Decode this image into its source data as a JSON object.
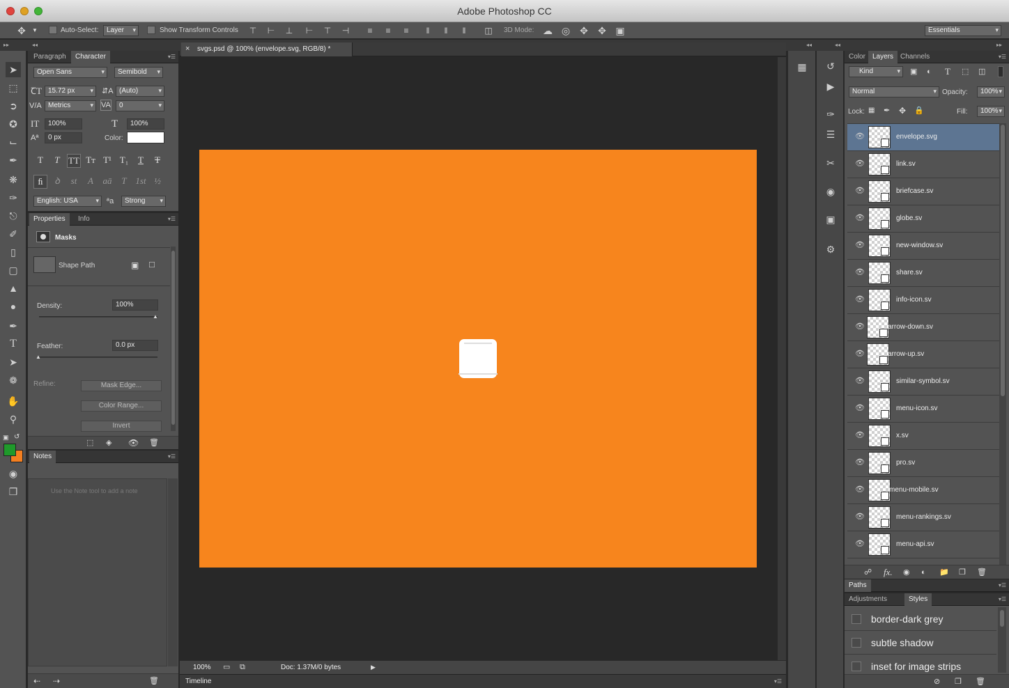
{
  "window": {
    "title": "Adobe Photoshop CC"
  },
  "options_bar": {
    "auto_select_label": "Auto-Select:",
    "auto_select_value": "Layer",
    "show_transform_label": "Show Transform Controls",
    "mode_3d_label": "3D Mode:",
    "workspace": "Essentials"
  },
  "character": {
    "tabs": [
      "Paragraph",
      "Character"
    ],
    "font_family": "Open Sans",
    "font_style": "Semibold",
    "font_size": "15.72 px",
    "leading": "(Auto)",
    "kerning": "Metrics",
    "tracking": "0",
    "vscale": "100%",
    "hscale": "100%",
    "baseline": "0 px",
    "color_label": "Color:",
    "style_glyphs": [
      "T",
      "T",
      "TT",
      "Tт",
      "T¹",
      "T₁",
      "T",
      "T"
    ],
    "ot_glyphs": [
      "ﬁ",
      "ꝺ",
      "st",
      "A",
      "aā",
      "T",
      "1st",
      "½"
    ],
    "language": "English: USA",
    "aa_icon": "ªa",
    "antialias": "Strong"
  },
  "properties": {
    "tabs": [
      "Properties",
      "Info"
    ],
    "section": "Masks",
    "shape_path_label": "Shape Path",
    "density_label": "Density:",
    "density_value": "100%",
    "density_level": 1.0,
    "feather_label": "Feather:",
    "feather_value": "0.0 px",
    "feather_level": 0.0,
    "refine_label": "Refine:",
    "mask_edge_btn": "Mask Edge...",
    "color_range_btn": "Color Range...",
    "invert_btn": "Invert"
  },
  "notes": {
    "tab": "Notes",
    "placeholder": "Use the Note tool to add a note"
  },
  "document": {
    "tab_title": "svgs.psd @ 100% (envelope.svg, RGB/8) *",
    "canvas_color": "#f7851d",
    "zoom": "100%",
    "doc_info": "Doc: 1.37M/0 bytes"
  },
  "timeline": {
    "label": "Timeline"
  },
  "layers_panel": {
    "tabs": [
      "Color",
      "Layers",
      "Channels"
    ],
    "filter_kind": "Kind",
    "blend_mode": "Normal",
    "opacity_label": "Opacity:",
    "opacity_value": "100%",
    "lock_label": "Lock:",
    "fill_label": "Fill:",
    "fill_value": "100%",
    "layers": [
      {
        "name": "envelope.svg"
      },
      {
        "name": "link.sv"
      },
      {
        "name": "briefcase.sv"
      },
      {
        "name": "globe.sv"
      },
      {
        "name": "new-window.sv"
      },
      {
        "name": "share.sv"
      },
      {
        "name": "info-icon.sv"
      },
      {
        "name": "arrow-down.sv"
      },
      {
        "name": "arrow-up.sv"
      },
      {
        "name": "similar-symbol.sv"
      },
      {
        "name": "menu-icon.sv"
      },
      {
        "name": "x.sv"
      },
      {
        "name": "pro.sv"
      },
      {
        "name": "menu-mobile.sv"
      },
      {
        "name": "menu-rankings.sv"
      },
      {
        "name": "menu-api.sv"
      }
    ],
    "footer_fx": "fx."
  },
  "paths_panel": {
    "tab": "Paths"
  },
  "styles_panel": {
    "tabs": [
      "Adjustments",
      "Styles"
    ],
    "styles": [
      {
        "name": "border-dark grey"
      },
      {
        "name": "subtle shadow"
      },
      {
        "name": "inset for image strips"
      }
    ]
  },
  "colors": {
    "foreground": "#1f9a2b",
    "background": "#f47f20",
    "selection": "#5d7592"
  }
}
